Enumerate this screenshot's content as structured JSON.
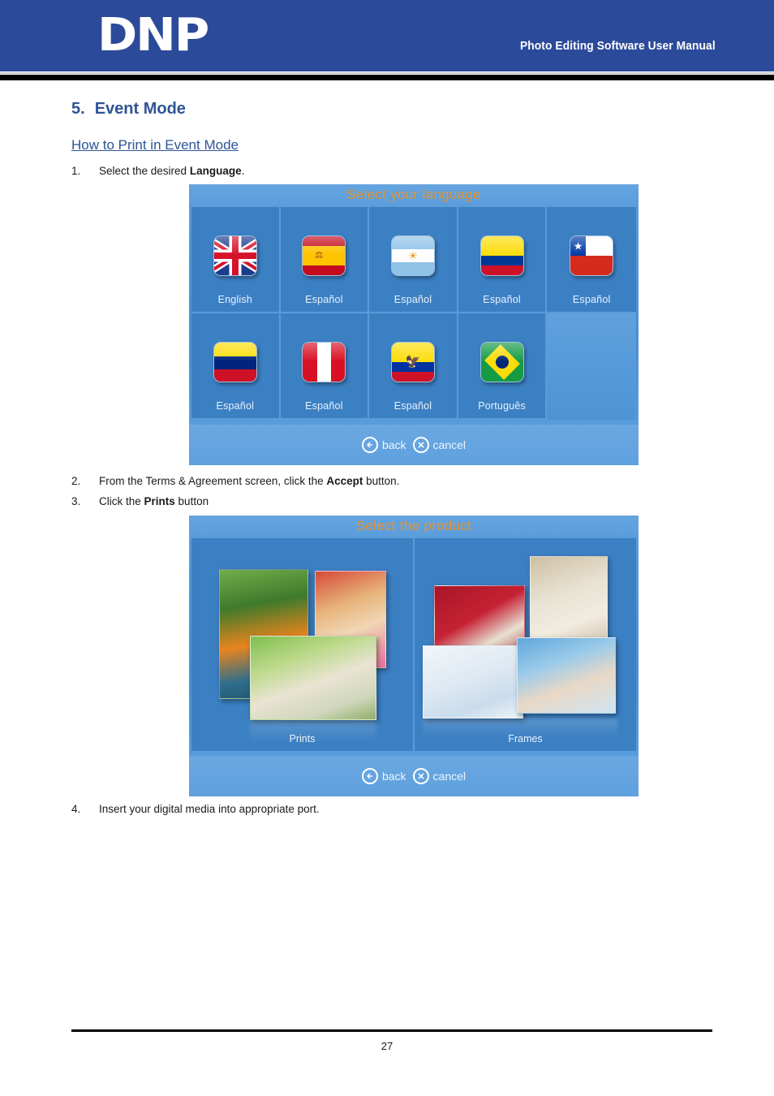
{
  "header": {
    "logo": "DNP",
    "title": "Photo Editing Software User Manual"
  },
  "section": {
    "number": "5.",
    "title": "Event Mode",
    "subheading": "How to Print in Event Mode"
  },
  "steps": [
    {
      "num": "1.",
      "pre": "Select the desired ",
      "bold": "Language",
      "post": "."
    },
    {
      "num": "2.",
      "pre": "From the Terms & Agreement screen, click the ",
      "bold": "Accept",
      "post": " button."
    },
    {
      "num": "3.",
      "pre": "Click the ",
      "bold": "Prints",
      "post": " button"
    },
    {
      "num": "4.",
      "pre": "Insert your digital media into appropriate port.",
      "bold": "",
      "post": ""
    }
  ],
  "language_screen": {
    "title": "Select your language",
    "tiles": [
      {
        "label": "English",
        "flag": "flag-uk"
      },
      {
        "label": "Español",
        "flag": "flag-spain"
      },
      {
        "label": "Español",
        "flag": "flag-argentina"
      },
      {
        "label": "Español",
        "flag": "flag-colombia"
      },
      {
        "label": "Español",
        "flag": "flag-chile"
      },
      {
        "label": "Español",
        "flag": "flag-venezuela"
      },
      {
        "label": "Español",
        "flag": "flag-peru"
      },
      {
        "label": "Español",
        "flag": "flag-ecuador"
      },
      {
        "label": "Português",
        "flag": "flag-brazil"
      }
    ],
    "nav": {
      "back": "back",
      "cancel": "cancel"
    }
  },
  "product_screen": {
    "title": "Select the product",
    "tiles": [
      {
        "label": "Prints"
      },
      {
        "label": "Frames"
      }
    ],
    "nav": {
      "back": "back",
      "cancel": "cancel"
    }
  },
  "footer": {
    "page_number": "27"
  },
  "colors": {
    "header_blue": "#2c4a9a",
    "heading_blue": "#2e5496",
    "kiosk_blue": "#4f95d8",
    "tile_blue": "#3c80c4",
    "title_orange": "#e8922c"
  }
}
